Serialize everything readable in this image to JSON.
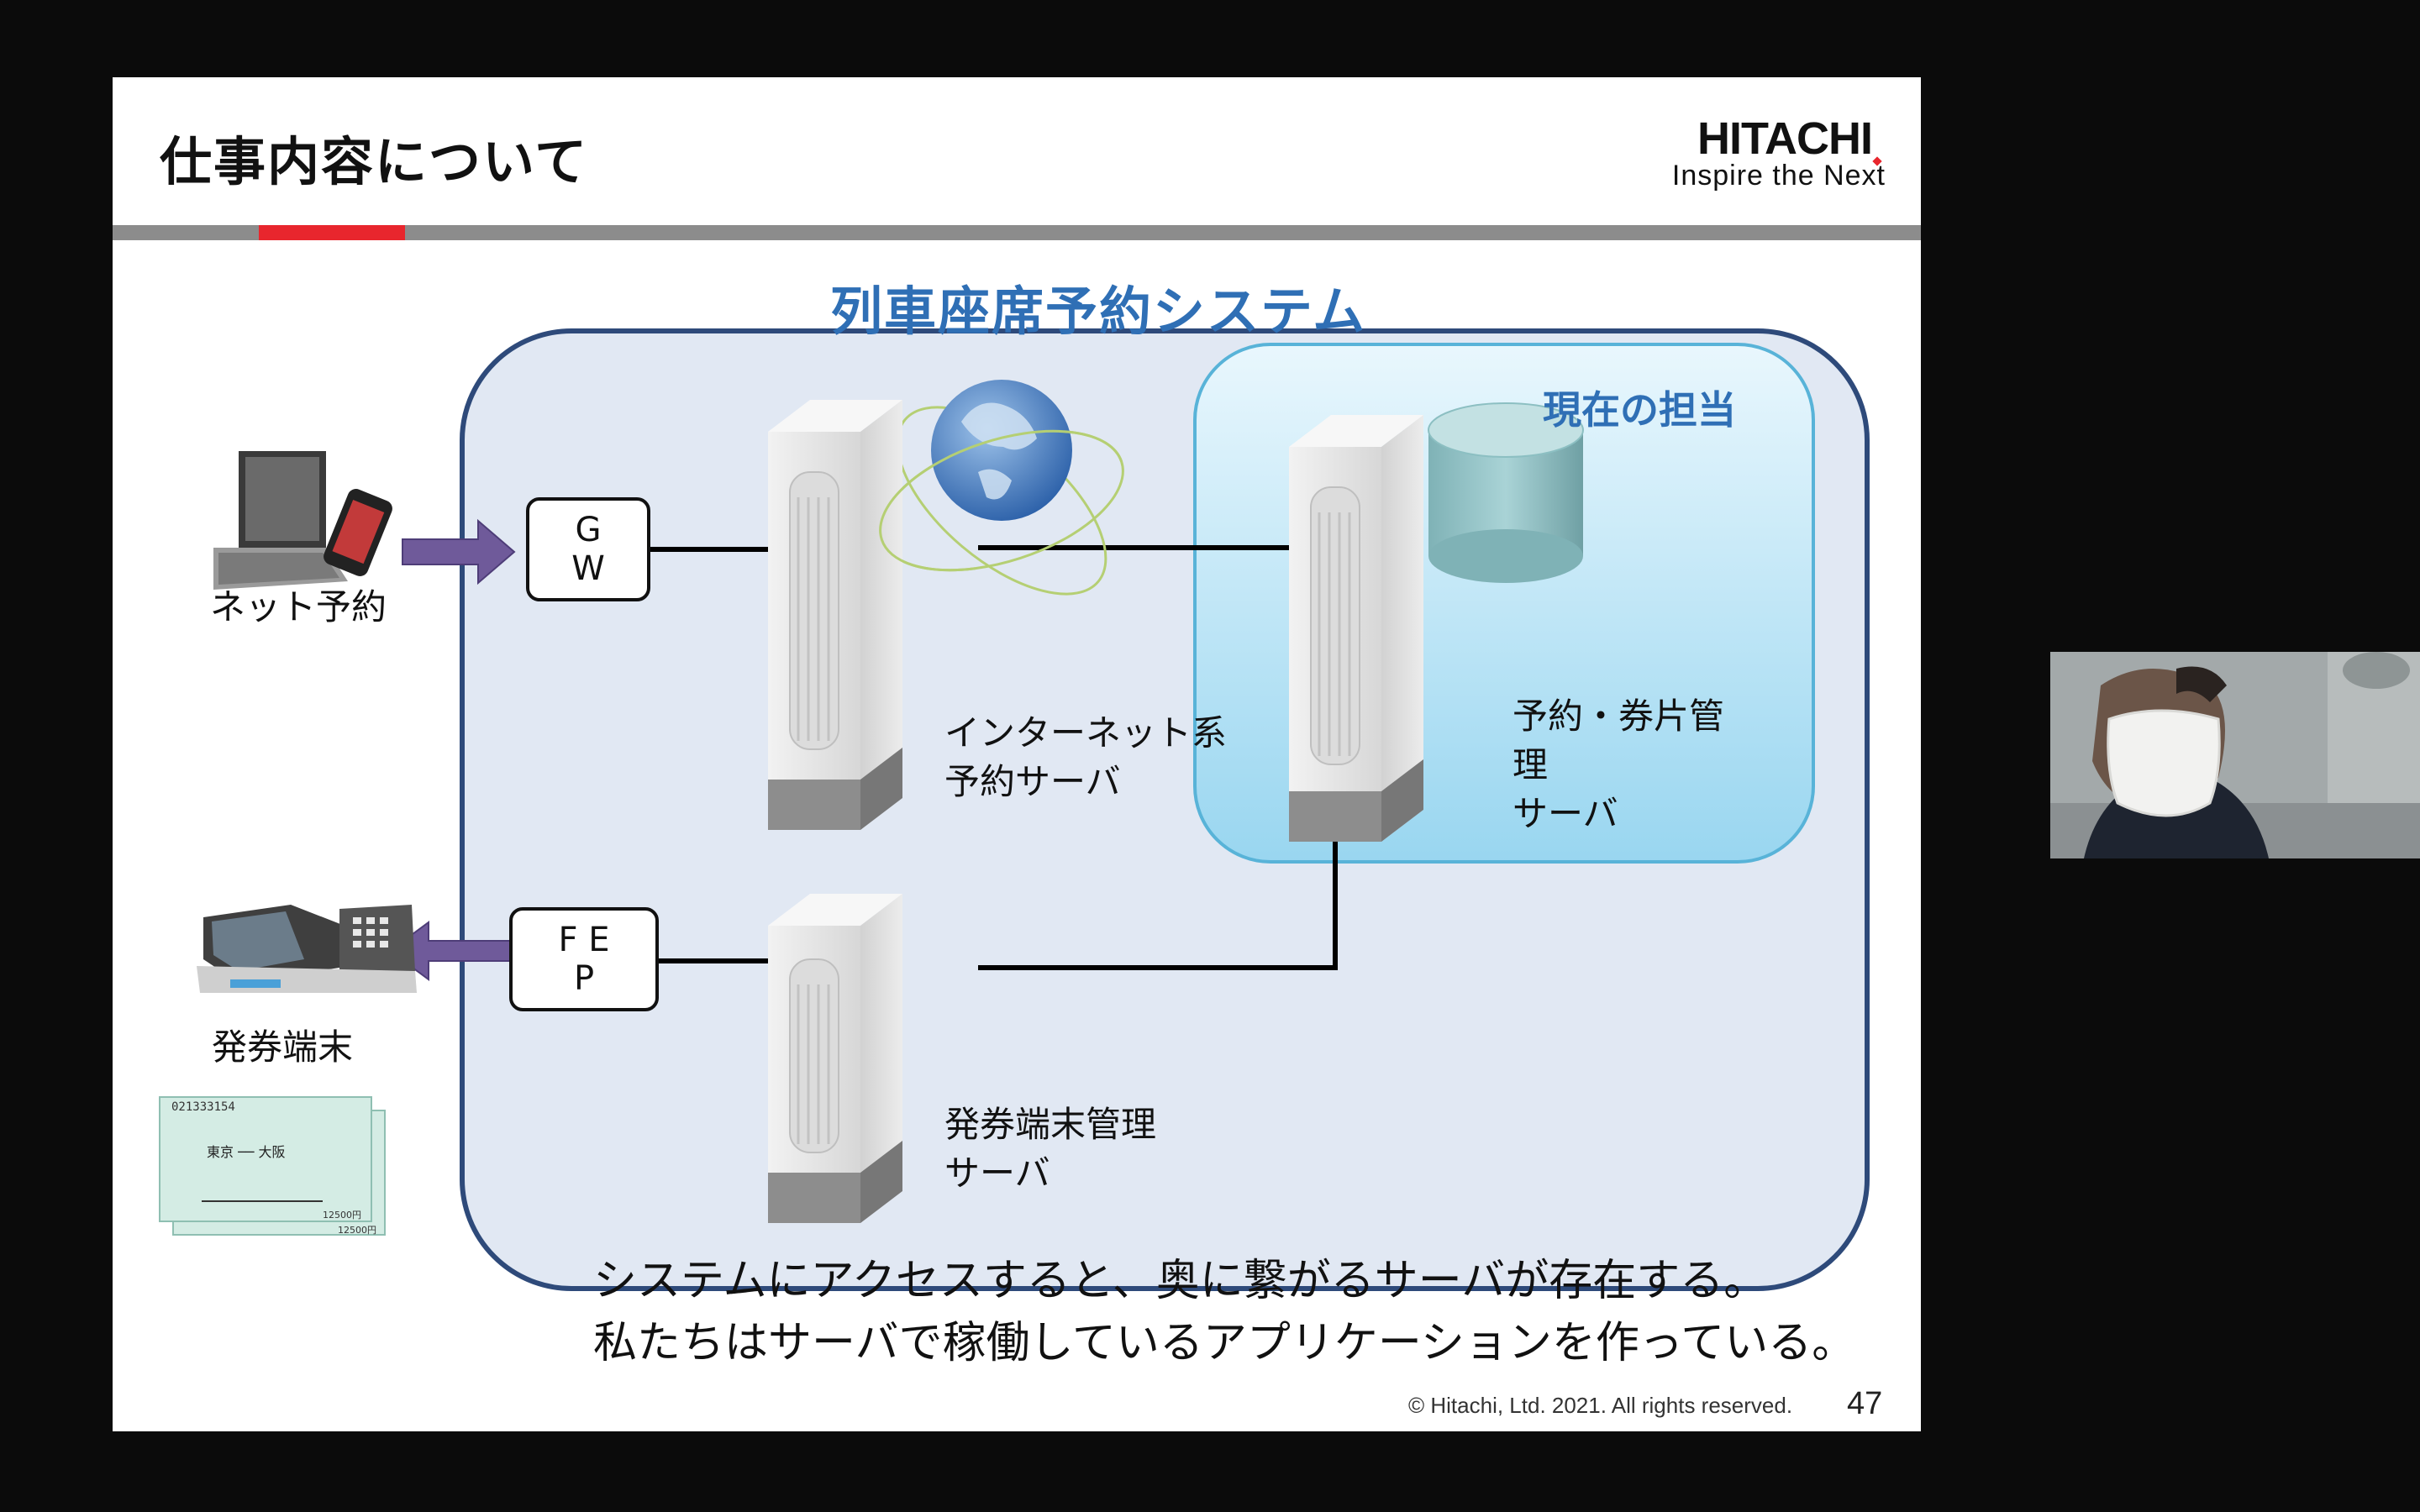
{
  "slide": {
    "title": "仕事内容について",
    "logo": {
      "brand": "HITACHI",
      "tagline": "Inspire the Next"
    },
    "system_title": "列車座席予約システム",
    "current_label": "現在の担当",
    "nodes": {
      "net_booking": "ネット予約",
      "gw": [
        "G",
        "W"
      ],
      "fep": [
        "F E",
        "P"
      ],
      "terminal": "発券端末",
      "internet_server": [
        "インターネット系",
        "予約サーバ"
      ],
      "reservation_server": [
        "予約・券片管",
        "理",
        "サーバ"
      ],
      "terminal_server": [
        "発券端末管理",
        "サーバ"
      ]
    },
    "ticket": {
      "number": "021333154",
      "route": "東京 ── 大阪",
      "price": "12500円"
    },
    "caption": [
      "システムにアクセスすると、奥に繋がるサーバが存在する。",
      "私たちはサーバで稼働しているアプリケーションを作っている。"
    ],
    "footer": "© Hitachi, Ltd. 2021. All rights reserved.",
    "page_number": "47"
  },
  "colors": {
    "accent_red": "#e8262d",
    "system_blue": "#2f6fb5",
    "arrow_purple": "#6f5a9a",
    "system_bg": "#e1e8f3",
    "current_bg": "#bfe6f6"
  }
}
